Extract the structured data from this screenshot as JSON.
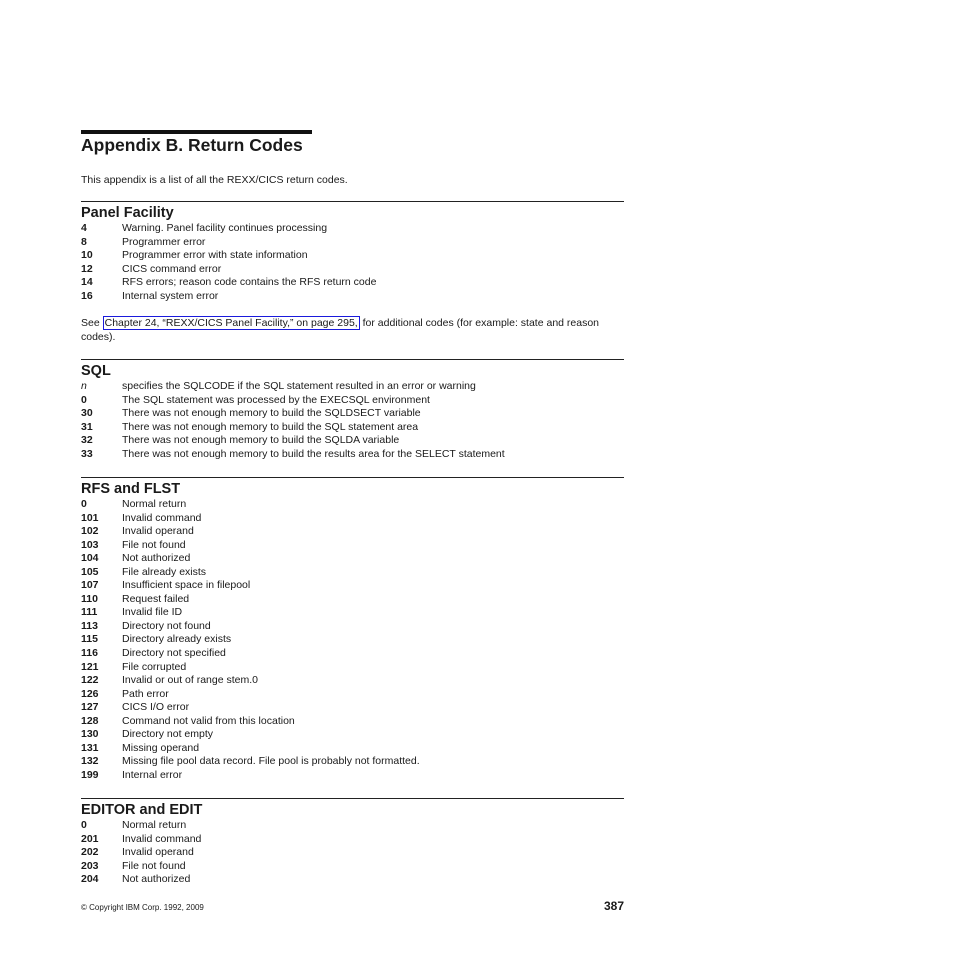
{
  "title": "Appendix B. Return Codes",
  "intro": "This appendix is a list of all the REXX/CICS return codes.",
  "sections": [
    {
      "heading": "Panel Facility",
      "rows": [
        {
          "code": "4",
          "desc": "Warning. Panel facility continues processing"
        },
        {
          "code": "8",
          "desc": "Programmer error"
        },
        {
          "code": "10",
          "desc": "Programmer error with state information"
        },
        {
          "code": "12",
          "desc": "CICS command error"
        },
        {
          "code": "14",
          "desc": "RFS errors; reason code contains the RFS return code"
        },
        {
          "code": "16",
          "desc": "Internal system error"
        }
      ],
      "note": {
        "prefix": "See ",
        "link": "Chapter 24, “REXX/CICS Panel Facility,” on page 295,",
        "suffix": " for additional codes (for example: state and reason codes)."
      }
    },
    {
      "heading": "SQL",
      "rows": [
        {
          "code": "n",
          "desc": "specifies the SQLCODE if the SQL statement resulted in an error or warning"
        },
        {
          "code": "0",
          "desc": "The SQL statement was processed by the EXECSQL environment"
        },
        {
          "code": "30",
          "desc": "There was not enough memory to build the SQLDSECT variable"
        },
        {
          "code": "31",
          "desc": "There was not enough memory to build the SQL statement area"
        },
        {
          "code": "32",
          "desc": "There was not enough memory to build the SQLDA variable"
        },
        {
          "code": "33",
          "desc": "There was not enough memory to build the results area for the SELECT statement"
        }
      ]
    },
    {
      "heading": "RFS and FLST",
      "rows": [
        {
          "code": "0",
          "desc": "Normal return"
        },
        {
          "code": "101",
          "desc": "Invalid command"
        },
        {
          "code": "102",
          "desc": "Invalid operand"
        },
        {
          "code": "103",
          "desc": "File not found"
        },
        {
          "code": "104",
          "desc": "Not authorized"
        },
        {
          "code": "105",
          "desc": "File already exists"
        },
        {
          "code": "107",
          "desc": "Insufficient space in filepool"
        },
        {
          "code": "110",
          "desc": "Request failed"
        },
        {
          "code": "111",
          "desc": "Invalid file ID"
        },
        {
          "code": "113",
          "desc": "Directory not found"
        },
        {
          "code": "115",
          "desc": "Directory already exists"
        },
        {
          "code": "116",
          "desc": "Directory not specified"
        },
        {
          "code": "121",
          "desc": "File corrupted"
        },
        {
          "code": "122",
          "desc": "Invalid or out of range stem.0"
        },
        {
          "code": "126",
          "desc": "Path error"
        },
        {
          "code": "127",
          "desc": "CICS I/O error"
        },
        {
          "code": "128",
          "desc": "Command not valid from this location"
        },
        {
          "code": "130",
          "desc": "Directory not empty"
        },
        {
          "code": "131",
          "desc": "Missing operand"
        },
        {
          "code": "132",
          "desc": "Missing file pool data record. File pool is probably not formatted."
        },
        {
          "code": "199",
          "desc": "Internal error"
        }
      ]
    },
    {
      "heading": "EDITOR and EDIT",
      "rows": [
        {
          "code": "0",
          "desc": "Normal return"
        },
        {
          "code": "201",
          "desc": "Invalid command"
        },
        {
          "code": "202",
          "desc": "Invalid operand"
        },
        {
          "code": "203",
          "desc": "File not found"
        },
        {
          "code": "204",
          "desc": "Not authorized"
        }
      ]
    }
  ],
  "footer": {
    "copyright": "© Copyright IBM Corp. 1992, 2009",
    "page_number": "387"
  }
}
